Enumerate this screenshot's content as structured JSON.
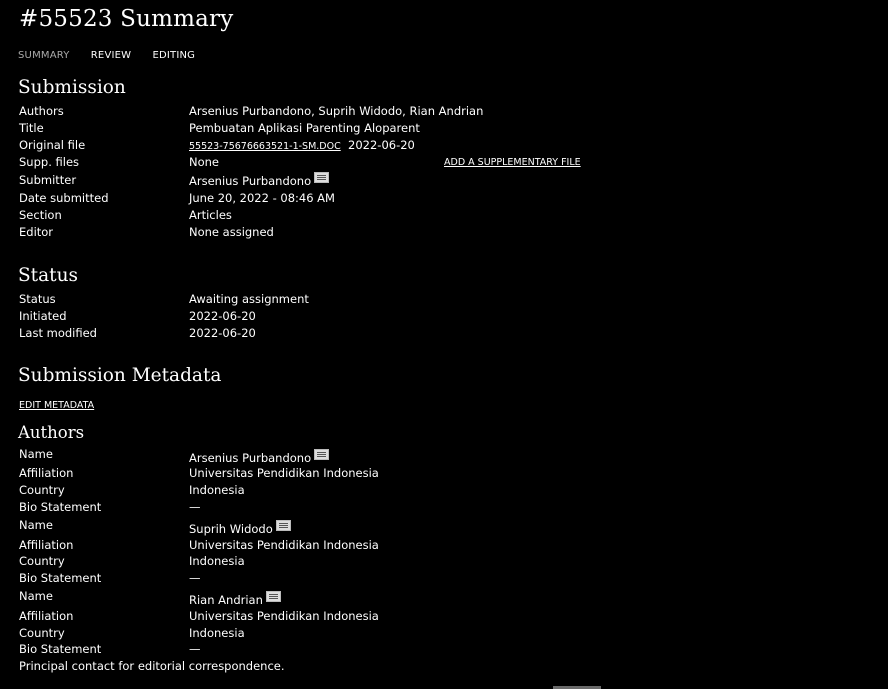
{
  "page_title": "#55523 Summary",
  "tabs": [
    {
      "label": "SUMMARY"
    },
    {
      "label": "REVIEW"
    },
    {
      "label": "EDITING"
    }
  ],
  "submission": {
    "heading": "Submission",
    "authors_label": "Authors",
    "authors_value": "Arsenius Purbandono, Suprih Widodo, Rian Andrian",
    "title_label": "Title",
    "title_value": "Pembuatan Aplikasi Parenting Aloparent",
    "original_file_label": "Original file",
    "original_file_link": "55523-75676663521-1-SM.DOC",
    "original_file_date": "2022-06-20",
    "supp_files_label": "Supp. files",
    "supp_files_value": "None",
    "add_supp_file": "ADD A SUPPLEMENTARY FILE",
    "submitter_label": "Submitter",
    "submitter_value": "Arsenius Purbandono",
    "date_submitted_label": "Date submitted",
    "date_submitted_value": "June 20, 2022 - 08:46 AM",
    "section_label": "Section",
    "section_value": "Articles",
    "editor_label": "Editor",
    "editor_value": "None assigned"
  },
  "status": {
    "heading": "Status",
    "status_label": "Status",
    "status_value": "Awaiting assignment",
    "initiated_label": "Initiated",
    "initiated_value": "2022-06-20",
    "last_modified_label": "Last modified",
    "last_modified_value": "2022-06-20"
  },
  "metadata": {
    "heading": "Submission Metadata",
    "edit_link": "EDIT METADATA",
    "authors_heading": "Authors",
    "authors": [
      {
        "name_label": "Name",
        "name": "Arsenius Purbandono",
        "affiliation_label": "Affiliation",
        "affiliation": "Universitas Pendidikan Indonesia",
        "country_label": "Country",
        "country": "Indonesia",
        "bio_label": "Bio Statement",
        "bio": "—"
      },
      {
        "name_label": "Name",
        "name": "Suprih Widodo",
        "affiliation_label": "Affiliation",
        "affiliation": "Universitas Pendidikan Indonesia",
        "country_label": "Country",
        "country": "Indonesia",
        "bio_label": "Bio Statement",
        "bio": "—"
      },
      {
        "name_label": "Name",
        "name": "Rian Andrian",
        "affiliation_label": "Affiliation",
        "affiliation": "Universitas Pendidikan Indonesia",
        "country_label": "Country",
        "country": "Indonesia",
        "bio_label": "Bio Statement",
        "bio": "—"
      }
    ],
    "principal_contact_note": "Principal contact for editorial correspondence."
  },
  "icons": {
    "email": "email-envelope-icon"
  },
  "colors": {
    "background": "#000000",
    "text": "#ffffff",
    "current_tab": "#aaaaaa"
  }
}
